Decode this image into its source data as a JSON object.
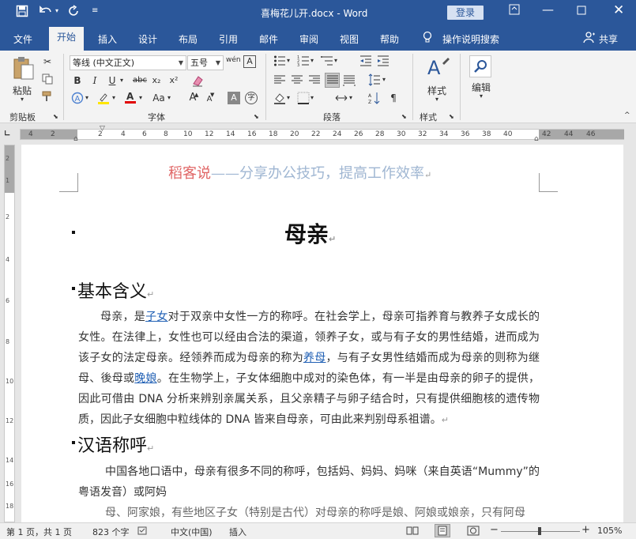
{
  "titlebar": {
    "filename": "喜梅花儿开.docx",
    "sep": "-",
    "app": "Word",
    "login": "登录",
    "icons": [
      "save-icon",
      "undo-icon",
      "redo-icon",
      "customize-icon",
      "ribbon-display-icon",
      "minimize-icon",
      "maximize-icon",
      "close-icon"
    ]
  },
  "tabs": [
    "文件",
    "开始",
    "插入",
    "设计",
    "布局",
    "引用",
    "邮件",
    "审阅",
    "视图",
    "帮助"
  ],
  "tellme": "操作说明搜索",
  "share": "共享",
  "ribbon": {
    "clipboard": {
      "paste": "粘贴",
      "label": "剪贴板"
    },
    "font": {
      "name": "等线 (中文正文)",
      "size": "五号",
      "label": "字体",
      "bold": "B",
      "italic": "I",
      "underline": "U",
      "strike": "abc",
      "sub": "x₂",
      "sup": "x²",
      "case": "Aa",
      "grow": "A",
      "shrink": "A",
      "wen": "wén",
      "charborder": "A",
      "shade": "A",
      "enclose": "字"
    },
    "paragraph": {
      "label": "段落"
    },
    "styles": {
      "label": "样式",
      "button": "样式"
    },
    "editing": {
      "button": "编辑"
    }
  },
  "ruler": {
    "marks": [
      "4",
      "2",
      "2",
      "4",
      "6",
      "8",
      "10",
      "12",
      "14",
      "16",
      "18",
      "20",
      "22",
      "24",
      "26",
      "28",
      "30",
      "32",
      "34",
      "36",
      "38",
      "40",
      "42",
      "44",
      "46"
    ],
    "vmarks": [
      "2",
      "1",
      "2",
      "4",
      "6",
      "8",
      "10",
      "12",
      "14",
      "16",
      "18"
    ]
  },
  "document": {
    "header_red": "稻客说",
    "header_blue": "——分享办公技巧，提高工作效率",
    "title": "母亲",
    "h1": "基本含义",
    "p1": {
      "a": "母亲，是",
      "link1": "子女",
      "b": "对于双亲中女性一方的称呼。在社会学上，母亲可指养育与教养子女成长的女性。在法律上，女性也可以经由合法的渠道，领养子女，或与有子女的男性结婚，进而成为该子女的法定母亲。经领养而成为母亲的称为",
      "link2": "养母",
      "c": "，与有子女男性结婚而成为母亲的则称为继母、後母或",
      "link3": "晚娘",
      "d": "。在生物学上，子女体细胞中成对的染色体，有一半是由母亲的卵子的提供，因此可借由 DNA 分析来辨别亲属关系，且父亲精子与卵子结合时，只有提供细胞核的遗传物质，因此子女细胞中粒线体的 DNA 皆来自母亲，可由此来判别母系祖谱。"
    },
    "h2": "汉语称呼",
    "p2": "中国各地口语中，母亲有很多不同的称呼，包括妈、妈妈、妈咪（来自英语“Mummy”的粤语发音）或阿",
    "p2b": "妈",
    "p3": "母、阿家娘，有些地区子女（特别是古代）对母亲的称呼是娘、阿娘或娘亲，只有阿母"
  },
  "statusbar": {
    "page": "第 1 页，共 1 页",
    "words": "823 个字",
    "lang": "中文(中国)",
    "mode": "插入",
    "zoom": "105%",
    "minus": "−",
    "plus": "+"
  }
}
